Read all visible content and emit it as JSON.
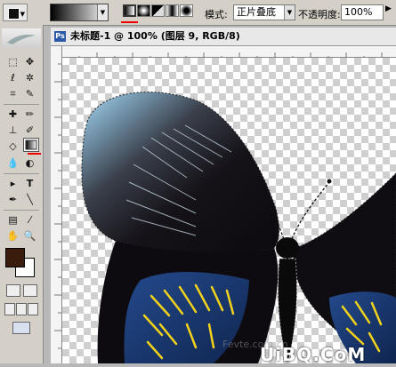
{
  "options_bar": {
    "mode_label": "模式:",
    "mode_value": "正片叠底",
    "opacity_label": "不透明度:",
    "opacity_value": "100%",
    "gradient_types": [
      "linear-gradient",
      "radial-gradient",
      "angle-gradient",
      "reflected-gradient",
      "diamond-gradient"
    ],
    "selected_gradient_type": "linear-gradient"
  },
  "toolbox": {
    "foreground_color": "#3a1c0c",
    "background_color": "#ffffff",
    "active_tool": "gradient-tool"
  },
  "document": {
    "title": "未标题-1 @ 100% (图层 9, RGB/8)"
  },
  "watermark": {
    "text": "UiBQ.CoM",
    "faint_text": "Fevte.com.cn"
  },
  "colors": {
    "highlight_red": "#e00000",
    "wing_dark": "#151218",
    "wing_blue": "#1b3a72",
    "wing_yellow": "#f2d21a"
  }
}
